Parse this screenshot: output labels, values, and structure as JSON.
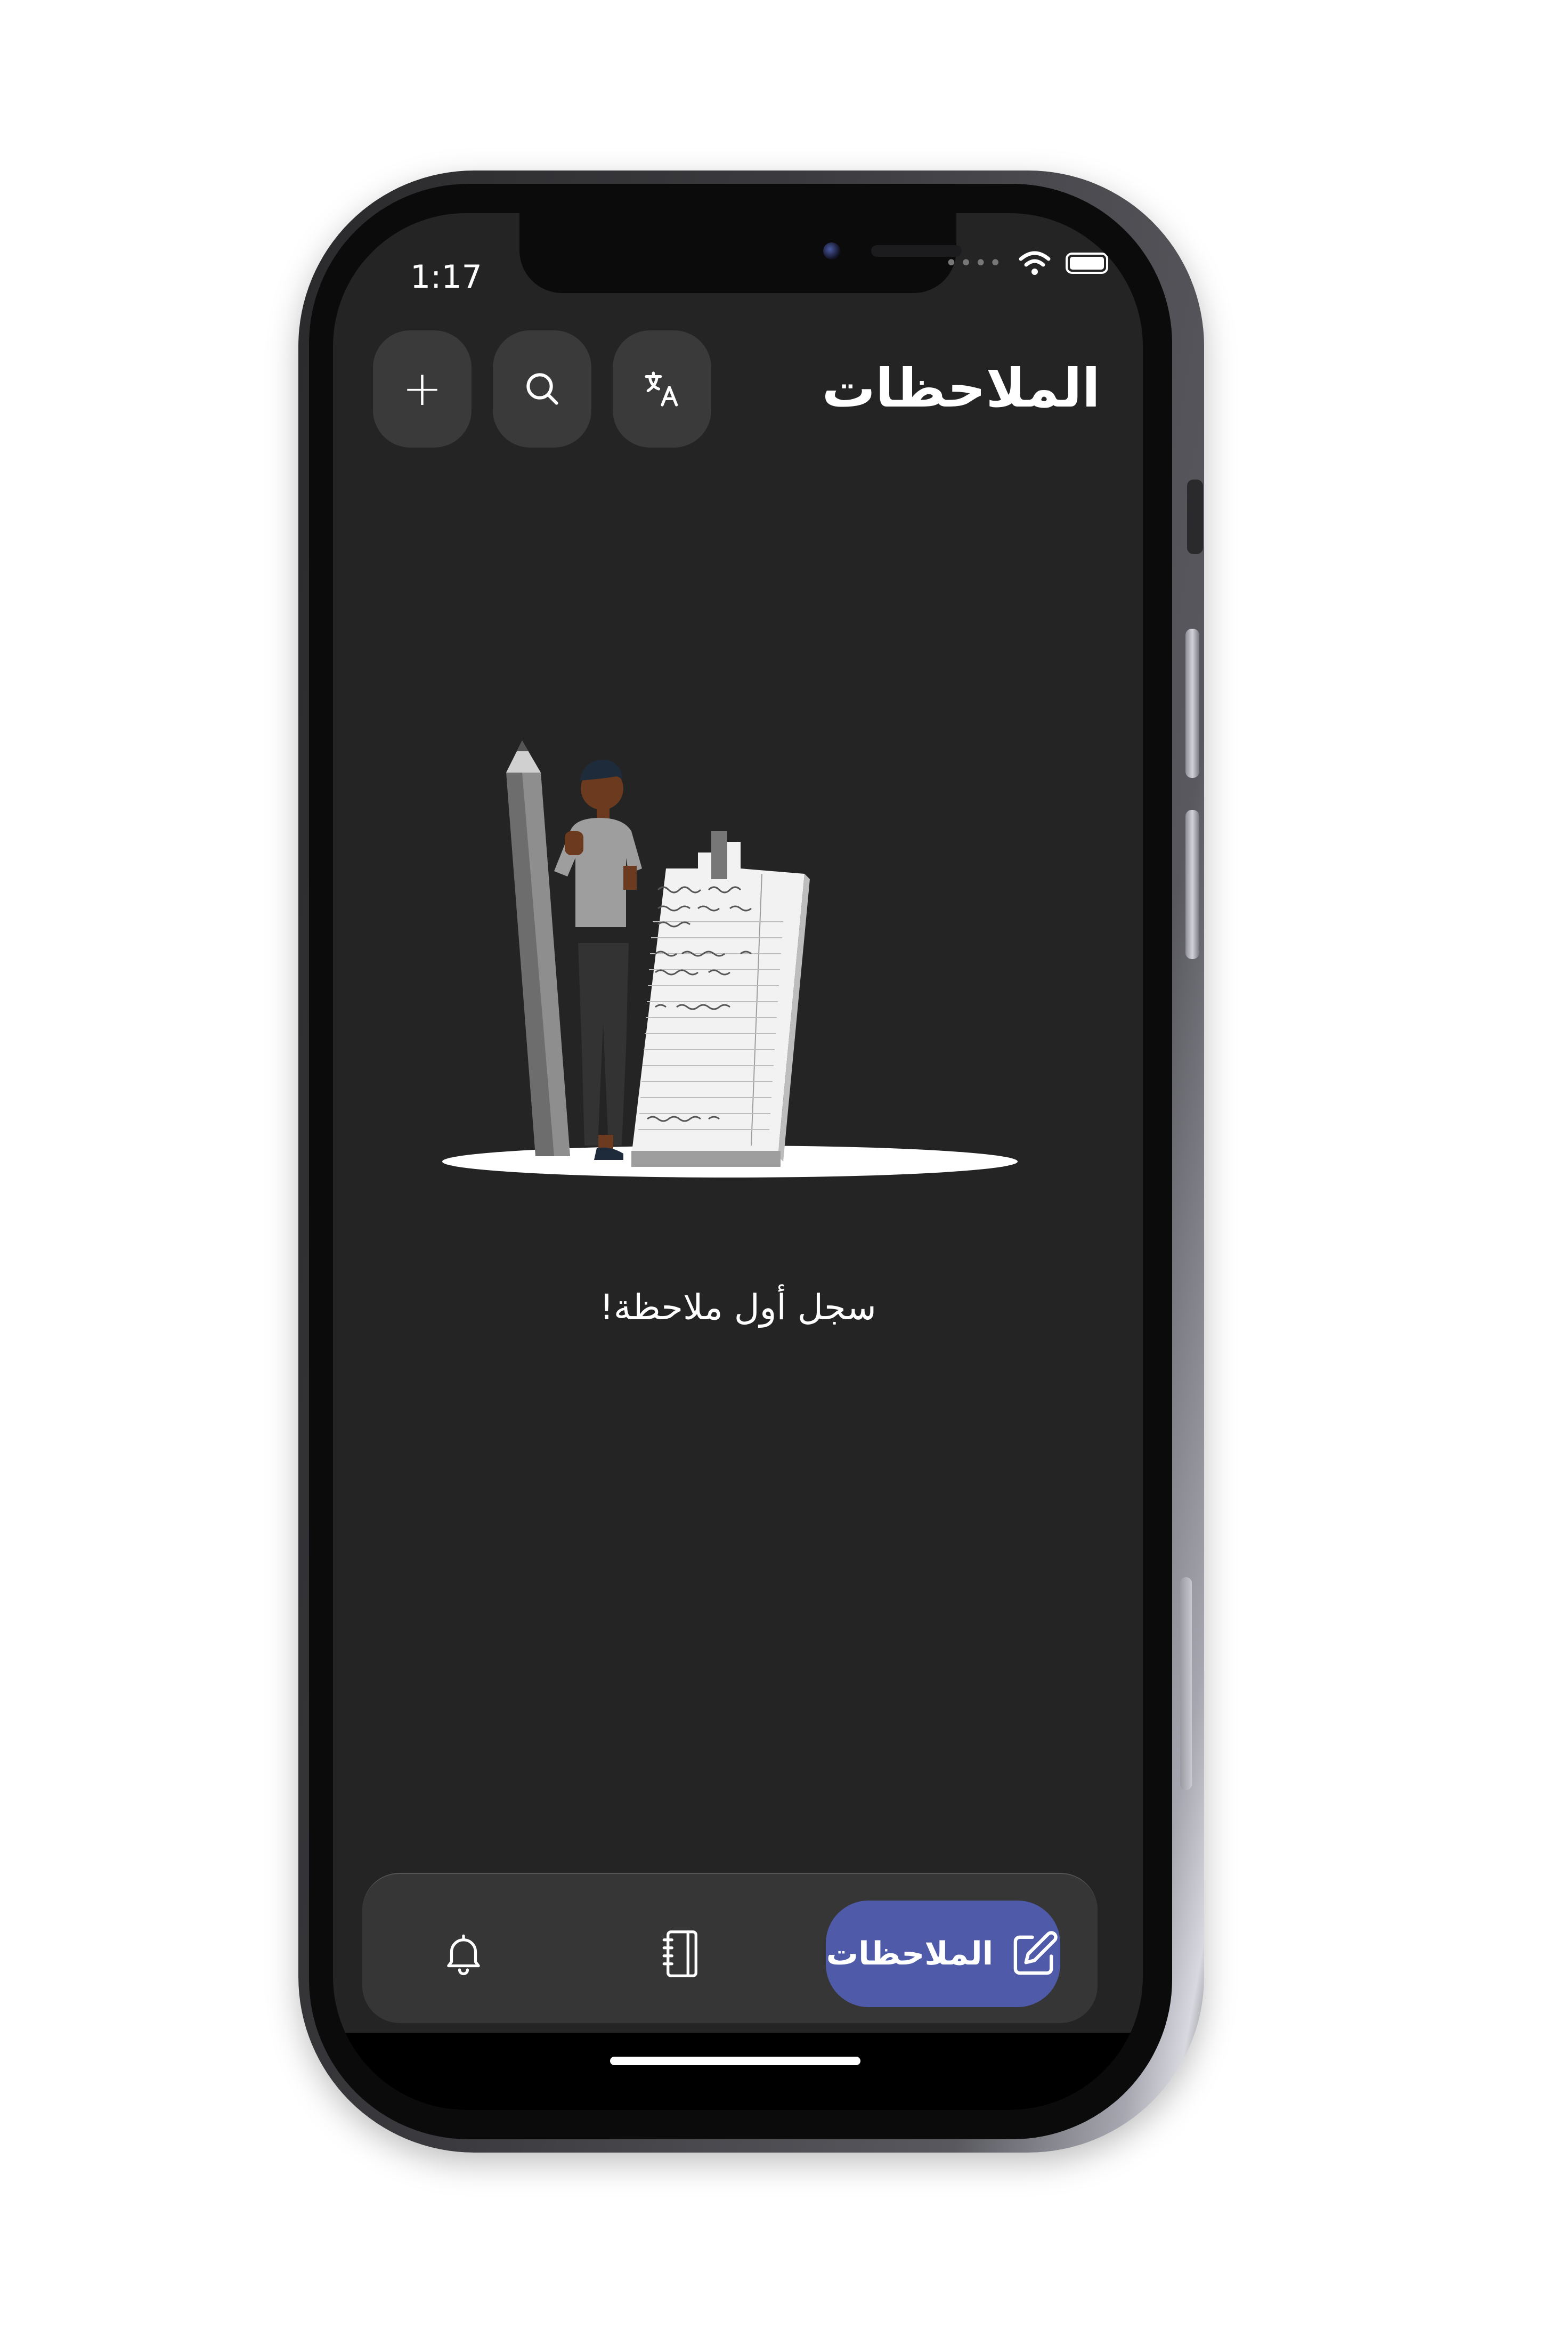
{
  "status_bar": {
    "time": "1:17"
  },
  "header": {
    "title": "الملاحظات",
    "buttons": [
      {
        "name": "translate",
        "icon": "translate-icon"
      },
      {
        "name": "search",
        "icon": "search-icon"
      },
      {
        "name": "add",
        "icon": "plus-icon"
      }
    ]
  },
  "empty_state": {
    "message": "سجل أول ملاحظة!"
  },
  "tab_bar": {
    "active_tab_label": "الملاحظات",
    "tabs": [
      {
        "name": "notes",
        "icon": "edit-icon",
        "label": "الملاحظات",
        "active": true
      },
      {
        "name": "notebook",
        "icon": "notebook-icon",
        "active": false
      },
      {
        "name": "reminders",
        "icon": "bell-icon",
        "active": false
      }
    ],
    "accent_color": "#4f5ba8"
  },
  "theme": {
    "background": "#242424",
    "button_bg": "#3a3a3a"
  }
}
